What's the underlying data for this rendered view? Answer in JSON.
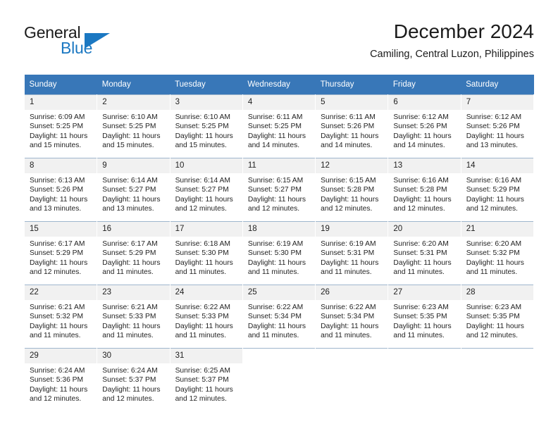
{
  "brand": {
    "name_part1": "General",
    "name_part2": "Blue",
    "flag_icon": "triangle-flag-icon"
  },
  "header": {
    "title": "December 2024",
    "subtitle": "Camiling, Central Luzon, Philippines"
  },
  "colors": {
    "header_blue": "#3877b8",
    "brand_blue": "#1b78c2",
    "daynum_bg": "#f1f1f1",
    "row_border": "#9fb6cd"
  },
  "weekdays": [
    "Sunday",
    "Monday",
    "Tuesday",
    "Wednesday",
    "Thursday",
    "Friday",
    "Saturday"
  ],
  "weeks": [
    [
      {
        "day": "1",
        "sunrise": "Sunrise: 6:09 AM",
        "sunset": "Sunset: 5:25 PM",
        "daylight1": "Daylight: 11 hours",
        "daylight2": "and 15 minutes."
      },
      {
        "day": "2",
        "sunrise": "Sunrise: 6:10 AM",
        "sunset": "Sunset: 5:25 PM",
        "daylight1": "Daylight: 11 hours",
        "daylight2": "and 15 minutes."
      },
      {
        "day": "3",
        "sunrise": "Sunrise: 6:10 AM",
        "sunset": "Sunset: 5:25 PM",
        "daylight1": "Daylight: 11 hours",
        "daylight2": "and 15 minutes."
      },
      {
        "day": "4",
        "sunrise": "Sunrise: 6:11 AM",
        "sunset": "Sunset: 5:25 PM",
        "daylight1": "Daylight: 11 hours",
        "daylight2": "and 14 minutes."
      },
      {
        "day": "5",
        "sunrise": "Sunrise: 6:11 AM",
        "sunset": "Sunset: 5:26 PM",
        "daylight1": "Daylight: 11 hours",
        "daylight2": "and 14 minutes."
      },
      {
        "day": "6",
        "sunrise": "Sunrise: 6:12 AM",
        "sunset": "Sunset: 5:26 PM",
        "daylight1": "Daylight: 11 hours",
        "daylight2": "and 14 minutes."
      },
      {
        "day": "7",
        "sunrise": "Sunrise: 6:12 AM",
        "sunset": "Sunset: 5:26 PM",
        "daylight1": "Daylight: 11 hours",
        "daylight2": "and 13 minutes."
      }
    ],
    [
      {
        "day": "8",
        "sunrise": "Sunrise: 6:13 AM",
        "sunset": "Sunset: 5:26 PM",
        "daylight1": "Daylight: 11 hours",
        "daylight2": "and 13 minutes."
      },
      {
        "day": "9",
        "sunrise": "Sunrise: 6:14 AM",
        "sunset": "Sunset: 5:27 PM",
        "daylight1": "Daylight: 11 hours",
        "daylight2": "and 13 minutes."
      },
      {
        "day": "10",
        "sunrise": "Sunrise: 6:14 AM",
        "sunset": "Sunset: 5:27 PM",
        "daylight1": "Daylight: 11 hours",
        "daylight2": "and 12 minutes."
      },
      {
        "day": "11",
        "sunrise": "Sunrise: 6:15 AM",
        "sunset": "Sunset: 5:27 PM",
        "daylight1": "Daylight: 11 hours",
        "daylight2": "and 12 minutes."
      },
      {
        "day": "12",
        "sunrise": "Sunrise: 6:15 AM",
        "sunset": "Sunset: 5:28 PM",
        "daylight1": "Daylight: 11 hours",
        "daylight2": "and 12 minutes."
      },
      {
        "day": "13",
        "sunrise": "Sunrise: 6:16 AM",
        "sunset": "Sunset: 5:28 PM",
        "daylight1": "Daylight: 11 hours",
        "daylight2": "and 12 minutes."
      },
      {
        "day": "14",
        "sunrise": "Sunrise: 6:16 AM",
        "sunset": "Sunset: 5:29 PM",
        "daylight1": "Daylight: 11 hours",
        "daylight2": "and 12 minutes."
      }
    ],
    [
      {
        "day": "15",
        "sunrise": "Sunrise: 6:17 AM",
        "sunset": "Sunset: 5:29 PM",
        "daylight1": "Daylight: 11 hours",
        "daylight2": "and 12 minutes."
      },
      {
        "day": "16",
        "sunrise": "Sunrise: 6:17 AM",
        "sunset": "Sunset: 5:29 PM",
        "daylight1": "Daylight: 11 hours",
        "daylight2": "and 11 minutes."
      },
      {
        "day": "17",
        "sunrise": "Sunrise: 6:18 AM",
        "sunset": "Sunset: 5:30 PM",
        "daylight1": "Daylight: 11 hours",
        "daylight2": "and 11 minutes."
      },
      {
        "day": "18",
        "sunrise": "Sunrise: 6:19 AM",
        "sunset": "Sunset: 5:30 PM",
        "daylight1": "Daylight: 11 hours",
        "daylight2": "and 11 minutes."
      },
      {
        "day": "19",
        "sunrise": "Sunrise: 6:19 AM",
        "sunset": "Sunset: 5:31 PM",
        "daylight1": "Daylight: 11 hours",
        "daylight2": "and 11 minutes."
      },
      {
        "day": "20",
        "sunrise": "Sunrise: 6:20 AM",
        "sunset": "Sunset: 5:31 PM",
        "daylight1": "Daylight: 11 hours",
        "daylight2": "and 11 minutes."
      },
      {
        "day": "21",
        "sunrise": "Sunrise: 6:20 AM",
        "sunset": "Sunset: 5:32 PM",
        "daylight1": "Daylight: 11 hours",
        "daylight2": "and 11 minutes."
      }
    ],
    [
      {
        "day": "22",
        "sunrise": "Sunrise: 6:21 AM",
        "sunset": "Sunset: 5:32 PM",
        "daylight1": "Daylight: 11 hours",
        "daylight2": "and 11 minutes."
      },
      {
        "day": "23",
        "sunrise": "Sunrise: 6:21 AM",
        "sunset": "Sunset: 5:33 PM",
        "daylight1": "Daylight: 11 hours",
        "daylight2": "and 11 minutes."
      },
      {
        "day": "24",
        "sunrise": "Sunrise: 6:22 AM",
        "sunset": "Sunset: 5:33 PM",
        "daylight1": "Daylight: 11 hours",
        "daylight2": "and 11 minutes."
      },
      {
        "day": "25",
        "sunrise": "Sunrise: 6:22 AM",
        "sunset": "Sunset: 5:34 PM",
        "daylight1": "Daylight: 11 hours",
        "daylight2": "and 11 minutes."
      },
      {
        "day": "26",
        "sunrise": "Sunrise: 6:22 AM",
        "sunset": "Sunset: 5:34 PM",
        "daylight1": "Daylight: 11 hours",
        "daylight2": "and 11 minutes."
      },
      {
        "day": "27",
        "sunrise": "Sunrise: 6:23 AM",
        "sunset": "Sunset: 5:35 PM",
        "daylight1": "Daylight: 11 hours",
        "daylight2": "and 11 minutes."
      },
      {
        "day": "28",
        "sunrise": "Sunrise: 6:23 AM",
        "sunset": "Sunset: 5:35 PM",
        "daylight1": "Daylight: 11 hours",
        "daylight2": "and 12 minutes."
      }
    ],
    [
      {
        "day": "29",
        "sunrise": "Sunrise: 6:24 AM",
        "sunset": "Sunset: 5:36 PM",
        "daylight1": "Daylight: 11 hours",
        "daylight2": "and 12 minutes."
      },
      {
        "day": "30",
        "sunrise": "Sunrise: 6:24 AM",
        "sunset": "Sunset: 5:37 PM",
        "daylight1": "Daylight: 11 hours",
        "daylight2": "and 12 minutes."
      },
      {
        "day": "31",
        "sunrise": "Sunrise: 6:25 AM",
        "sunset": "Sunset: 5:37 PM",
        "daylight1": "Daylight: 11 hours",
        "daylight2": "and 12 minutes."
      },
      null,
      null,
      null,
      null
    ]
  ]
}
